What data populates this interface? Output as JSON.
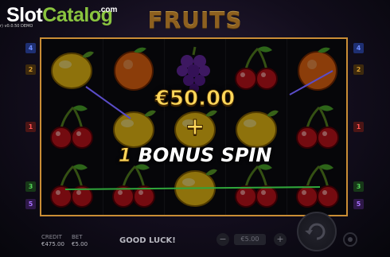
{
  "header": {
    "brand_slot": "Slot",
    "brand_catalog": "Catalog",
    "brand_com": ".com",
    "version": "r) v0.0.50 DEMO",
    "game_title": "FRUITS"
  },
  "reels": [
    [
      "lemon",
      "cherry",
      "cherry"
    ],
    [
      "orange",
      "lemon",
      "cherry"
    ],
    [
      "grapes",
      "lemon",
      "lemon"
    ],
    [
      "cherry",
      "lemon",
      "cherry"
    ],
    [
      "orange",
      "cherry",
      "cherry"
    ]
  ],
  "line_markers": {
    "left": [
      "4",
      "2",
      "1",
      "3",
      "5"
    ],
    "right": [
      "4",
      "2",
      "1",
      "3",
      "5"
    ]
  },
  "win": {
    "amount": "€50.00",
    "plus": "+",
    "bonus_count": "1",
    "bonus_label": "BONUS SPIN"
  },
  "footer": {
    "credit_label": "CREDIT",
    "credit_value": "€475.00",
    "bet_label": "BET",
    "bet_value": "€5.00",
    "message": "GOOD LUCK!",
    "stake_value": "€5.00",
    "minus_symbol": "−",
    "plus_symbol": "+"
  },
  "colors": {
    "frame": "#c98d35",
    "win_gold": "#ffd75a",
    "brand_green": "#8ac43f",
    "marker_blue": "#6d8bff",
    "marker_orange": "#d49a2e",
    "marker_red": "#ff5252",
    "marker_green": "#55d45a",
    "marker_purple": "#a870ff"
  }
}
